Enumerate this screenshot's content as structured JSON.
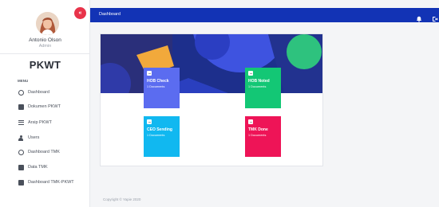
{
  "user": {
    "name": "Antonio Olson",
    "role": "Admin"
  },
  "sidebar": {
    "brand": "PKWT",
    "menu_heading": "MENU",
    "items": [
      {
        "label": "Dashboard",
        "icon": "dashboard-icon"
      },
      {
        "label": "Dokumen PKWT",
        "icon": "document-icon"
      },
      {
        "label": "Arsip PKWT",
        "icon": "archive-icon"
      },
      {
        "label": "Users",
        "icon": "users-icon"
      },
      {
        "label": "Dashboard TMK",
        "icon": "dashboard-icon"
      },
      {
        "label": "Data TMK",
        "icon": "data-icon"
      },
      {
        "label": "Dashboard TMK-PKWT",
        "icon": "dashboard-icon"
      }
    ]
  },
  "collapse_button": {
    "label": "«"
  },
  "topbar": {
    "title": "Dashboard",
    "icons": [
      "bell-icon",
      "logout-icon"
    ]
  },
  "tiles": [
    {
      "title": "HOB Check",
      "subtitle": "1 Documents",
      "color": "#5b6cf0"
    },
    {
      "title": "HOB Noted",
      "subtitle": "1 Documents",
      "color": "#13c775"
    },
    {
      "title": "CEO Sending",
      "subtitle": "1 Documents",
      "color": "#11b8f0"
    },
    {
      "title": "TMK Done",
      "subtitle": "1 Documents",
      "color": "#ee1457"
    }
  ],
  "colors": {
    "topbar": "#1233b5",
    "accent_red": "#e8334a",
    "hero_bg": "#1d2f8c"
  },
  "footer": {
    "text": "Copyright © Yapie 2020"
  }
}
